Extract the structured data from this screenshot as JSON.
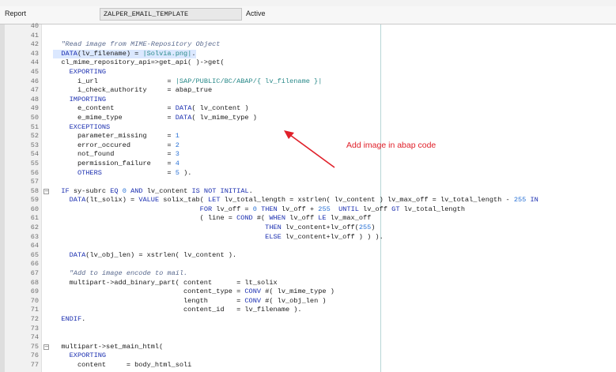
{
  "header": {
    "report_label": "Report",
    "program_name": "ZALPER_EMAIL_TEMPLATE",
    "status": "Active"
  },
  "annotation": {
    "text": "Add image in abap code",
    "color": "#e0202a"
  },
  "code_lines": [
    {
      "no": "40",
      "html": ""
    },
    {
      "no": "41",
      "html": ""
    },
    {
      "no": "42",
      "html": "  <span class=\"cmt\">\"Read image from MIME-Repository Object</span>"
    },
    {
      "no": "43",
      "html": "  <span class=\"kw\">DATA</span>(lv_filename) = <span class=\"str\">|Solvia.png|</span>.",
      "highlight": true
    },
    {
      "no": "44",
      "html": "  cl_mime_repository_api=>get_api( )->get("
    },
    {
      "no": "45",
      "html": "    <span class=\"kw\">EXPORTING</span>"
    },
    {
      "no": "46",
      "html": "      i_url                 = <span class=\"str\">|SAP/PUBLIC/BC/ABAP/{ lv_filename }|</span>"
    },
    {
      "no": "47",
      "html": "      i_check_authority     = abap_true"
    },
    {
      "no": "48",
      "html": "    <span class=\"kw\">IMPORTING</span>"
    },
    {
      "no": "49",
      "html": "      e_content             = <span class=\"kw\">DATA</span>( lv_content )"
    },
    {
      "no": "50",
      "html": "      e_mime_type           = <span class=\"kw\">DATA</span>( lv_mime_type )"
    },
    {
      "no": "51",
      "html": "    <span class=\"kw\">EXCEPTIONS</span>"
    },
    {
      "no": "52",
      "html": "      parameter_missing     = <span class=\"num\">1</span>"
    },
    {
      "no": "53",
      "html": "      error_occured         = <span class=\"num\">2</span>"
    },
    {
      "no": "54",
      "html": "      not_found             = <span class=\"num\">3</span>"
    },
    {
      "no": "55",
      "html": "      permission_failure    = <span class=\"num\">4</span>"
    },
    {
      "no": "56",
      "html": "      <span class=\"kw\">OTHERS</span>                = <span class=\"num\">5</span> )."
    },
    {
      "no": "57",
      "html": ""
    },
    {
      "no": "58",
      "html": "  <span class=\"kw\">IF</span> sy-subrc <span class=\"kw\">EQ</span> <span class=\"num\">0</span> <span class=\"kw\">AND</span> lv_content <span class=\"kw\">IS NOT INITIAL</span>.",
      "fold": true
    },
    {
      "no": "59",
      "html": "    <span class=\"kw\">DATA</span>(lt_solix) = <span class=\"kw\">VALUE</span> solix_tab( <span class=\"kw\">LET</span> lv_total_length = xstrlen( lv_content ) lv_max_off = lv_total_length - <span class=\"num\">255</span> <span class=\"kw\">IN</span>"
    },
    {
      "no": "60",
      "html": "                                    <span class=\"kw\">FOR</span> lv_off = <span class=\"num\">0</span> <span class=\"kw\">THEN</span> lv_off + <span class=\"num\">255</span>  <span class=\"kw\">UNTIL</span> lv_off <span class=\"kw\">GT</span> lv_total_length"
    },
    {
      "no": "61",
      "html": "                                    ( line = <span class=\"kw\">COND</span> #( <span class=\"kw\">WHEN</span> lv_off <span class=\"kw\">LE</span> lv_max_off"
    },
    {
      "no": "62",
      "html": "                                                    <span class=\"kw\">THEN</span> lv_content+lv_off(<span class=\"num\">255</span>)"
    },
    {
      "no": "63",
      "html": "                                                    <span class=\"kw\">ELSE</span> lv_content+lv_off ) ) )."
    },
    {
      "no": "64",
      "html": ""
    },
    {
      "no": "65",
      "html": "    <span class=\"kw\">DATA</span>(lv_obj_len) = xstrlen( lv_content )."
    },
    {
      "no": "66",
      "html": ""
    },
    {
      "no": "67",
      "html": "    <span class=\"cmt\">\"Add to image encode to mail.</span>"
    },
    {
      "no": "68",
      "html": "    multipart->add_binary_part( content      = lt_solix"
    },
    {
      "no": "69",
      "html": "                                content_type = <span class=\"kw\">CONV</span> #( lv_mime_type )"
    },
    {
      "no": "70",
      "html": "                                length       = <span class=\"kw\">CONV</span> #( lv_obj_len )"
    },
    {
      "no": "71",
      "html": "                                content_id   = lv_filename )."
    },
    {
      "no": "72",
      "html": "  <span class=\"kw\">ENDIF</span>."
    },
    {
      "no": "73",
      "html": ""
    },
    {
      "no": "74",
      "html": ""
    },
    {
      "no": "75",
      "html": "  multipart->set_main_html(",
      "fold": true
    },
    {
      "no": "76",
      "html": "    <span class=\"kw\">EXPORTING</span>"
    },
    {
      "no": "77",
      "html": "      content     = body_html_soli"
    }
  ]
}
